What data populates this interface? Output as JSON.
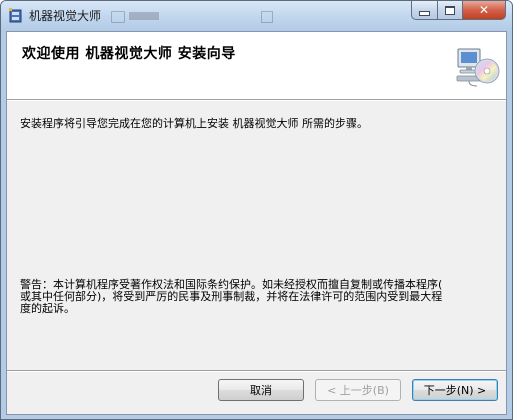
{
  "window": {
    "title": "机器视觉大师",
    "caption_buttons": {
      "minimize_icon": "minimize-icon",
      "maximize_icon": "maximize-icon",
      "close_icon": "close-icon",
      "close_glyph": "✕"
    }
  },
  "banner": {
    "title": "欢迎使用  机器视觉大师  安装向导",
    "icon": "computer-cd-icon"
  },
  "body": {
    "intro": "安装程序将引导您完成在您的计算机上安装 机器视觉大师 所需的步骤。",
    "warning_lines": [
      "警告：本计算机程序受著作权法和国际条约保护。如未经授权而擅自复制或传播本程序(",
      "或其中任何部分)，将受到严厉的民事及刑事制裁，并将在法律许可的范围内受到最大程",
      "度的起诉。"
    ]
  },
  "buttons": {
    "cancel": "取消",
    "back": "< 上一步(B)",
    "next": "下一步(N) >"
  },
  "colors": {
    "titlebar": "#c2d7ee",
    "client_bg": "#f0f0f0",
    "close_button": "#c0401f"
  }
}
